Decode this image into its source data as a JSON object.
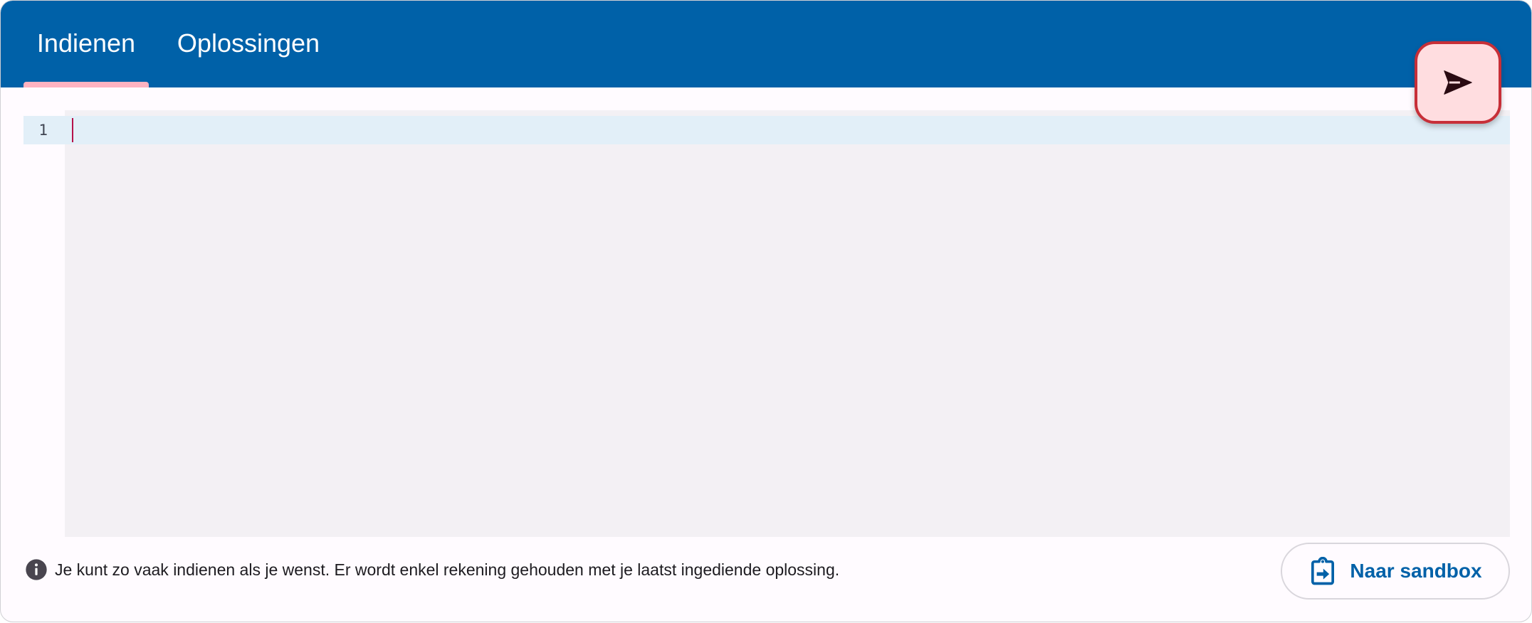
{
  "tabs": {
    "submit_label": "Indienen",
    "solutions_label": "Oplossingen"
  },
  "editor": {
    "line_numbers": [
      "1"
    ],
    "content": ""
  },
  "submit_button": {
    "icon": "send-icon"
  },
  "footer": {
    "info_icon": "info-icon",
    "info_text": "Je kunt zo vaak indienen als je wenst. Er wordt enkel rekening gehouden met je laatst ingediende oplossing.",
    "sandbox_icon": "clipboard-arrow-icon",
    "sandbox_label": "Naar sandbox"
  },
  "colors": {
    "header": "#0061a8",
    "tab_indicator": "#ffb3c1",
    "submit_button_fill": "#ffdde0",
    "submit_button_border": "#c72f38",
    "editor_background": "#f3f0f4",
    "active_line": "#e2eff8",
    "cursor": "#b5124a",
    "link_blue": "#0061a8"
  }
}
